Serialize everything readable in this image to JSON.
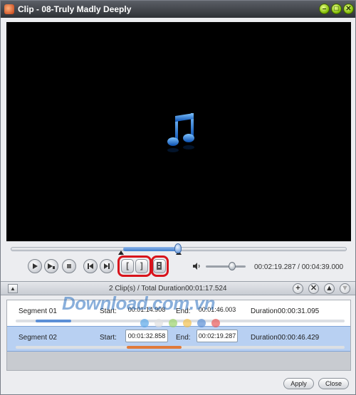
{
  "window": {
    "title": "Clip - 08-Truly Madly Deeply",
    "minimize_symbol": "–",
    "maximize_symbol": "□",
    "close_symbol": "✕"
  },
  "player": {
    "time_current": "00:02:19.287",
    "time_total": "00:04:39.000",
    "time_separator": " / ",
    "selection_start_fraction": 0.357,
    "selection_end_fraction": 0.5,
    "volume_fraction": 0.57
  },
  "clip_header": {
    "clip_count": "2 Clip(s) /",
    "total_duration_label": "Total Duration",
    "total_duration": "00:01:17.524"
  },
  "segments": [
    {
      "name": "Segment 01",
      "start_label": "Start:",
      "start": "00:01:14.908",
      "end_label": "End:",
      "end": "00:01:46.003",
      "duration_label": "Duration",
      "duration": "00:00:31.095"
    },
    {
      "name": "Segment 02",
      "start_label": "Start:",
      "start": "00:01:32.858",
      "end_label": "End:",
      "end": "00:02:19.287",
      "duration_label": "Duration",
      "duration": "00:00:46.429"
    }
  ],
  "watermark": {
    "text": "Download.com.vn",
    "dot_colors": [
      "#5aa7e8",
      "#e0e0e0",
      "#9bd36b",
      "#f2c14e",
      "#5a8fd6",
      "#e85a5a"
    ]
  },
  "footer": {
    "apply_label": "Apply",
    "close_label": "Close"
  },
  "colors": {
    "highlight_ring": "#d8141c",
    "selection": "#3f7ccc",
    "segment2_bar": "#e07a3a"
  }
}
